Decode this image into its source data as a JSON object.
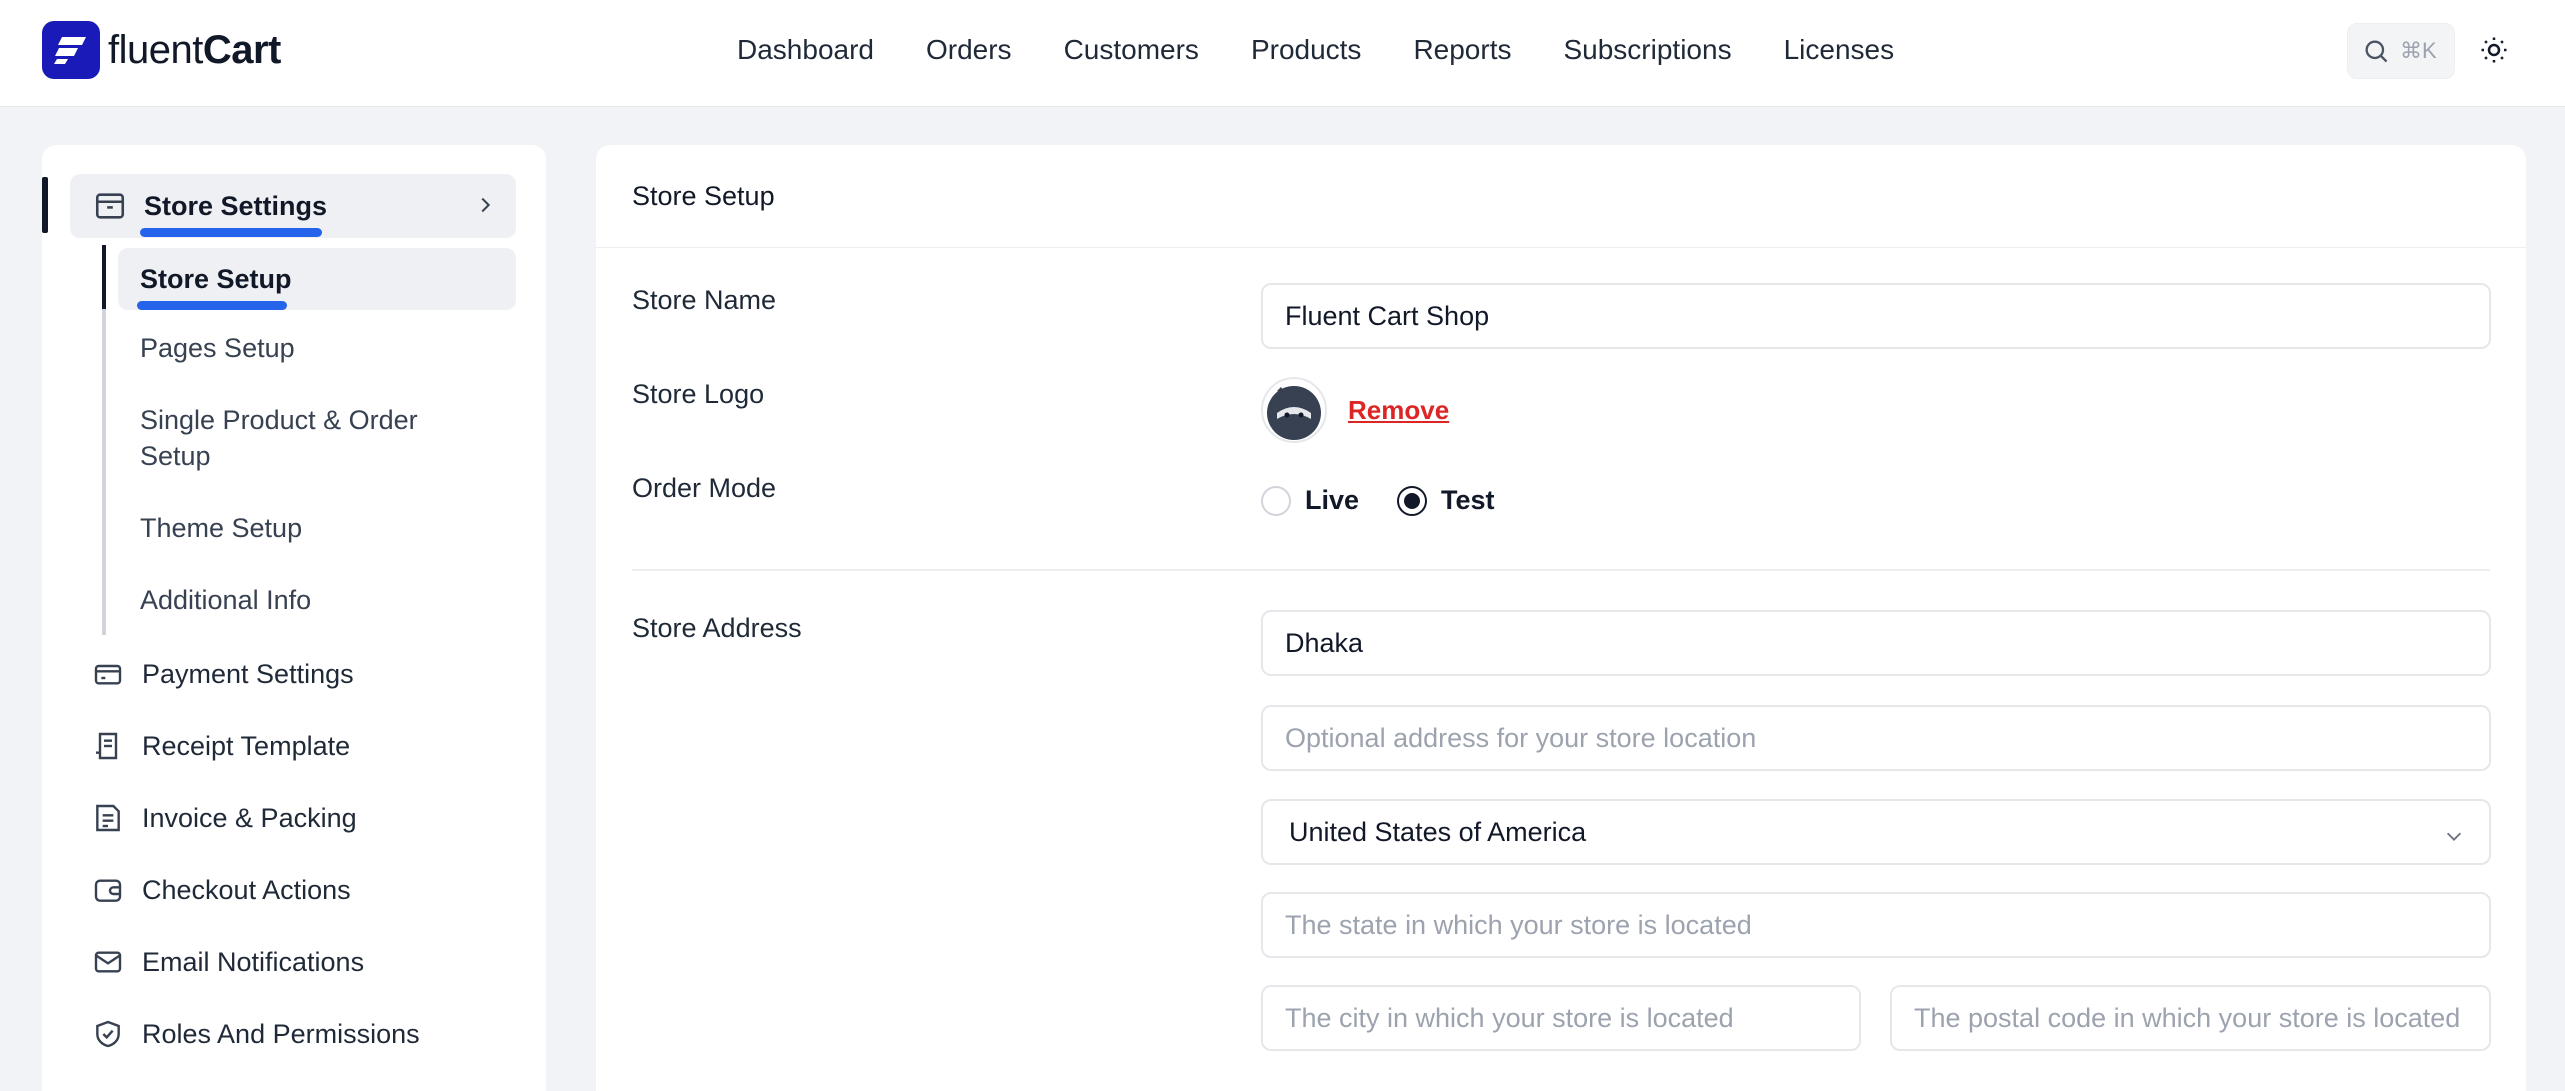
{
  "app": {
    "brand_prefix": "fluent",
    "brand_suffix": "Cart",
    "accent": "#1a1ab8",
    "highlight": "#2563eb"
  },
  "nav": {
    "items": [
      "Dashboard",
      "Orders",
      "Customers",
      "Products",
      "Reports",
      "Subscriptions",
      "Licenses"
    ],
    "search_shortcut": "⌘K"
  },
  "sidebar": {
    "group": {
      "label": "Store Settings",
      "icon": "archive-box-icon"
    },
    "sub_items": [
      "Store Setup",
      "Pages Setup",
      "Single Product & Order Setup",
      "Theme Setup",
      "Additional Info"
    ],
    "items": [
      {
        "label": "Payment Settings",
        "icon": "credit-card-icon"
      },
      {
        "label": "Receipt Template",
        "icon": "receipt-icon"
      },
      {
        "label": "Invoice & Packing",
        "icon": "invoice-icon"
      },
      {
        "label": "Checkout Actions",
        "icon": "wallet-icon"
      },
      {
        "label": "Email Notifications",
        "icon": "envelope-icon"
      },
      {
        "label": "Roles And Permissions",
        "icon": "shield-check-icon"
      }
    ]
  },
  "panel": {
    "title": "Store Setup",
    "store_name": {
      "label": "Store Name",
      "value": "Fluent Cart Shop"
    },
    "store_logo": {
      "label": "Store Logo",
      "remove_label": "Remove"
    },
    "order_mode": {
      "label": "Order Mode",
      "options": [
        "Live",
        "Test"
      ],
      "selected": "Test"
    },
    "store_address": {
      "label": "Store Address",
      "address_line_1": "Dhaka",
      "address_line_2_placeholder": "Optional address for your store location",
      "country": "United States of America",
      "state_placeholder": "The state in which your store is located",
      "city_placeholder": "The city in which your store is located",
      "postal_placeholder": "The postal code in which your store is located"
    }
  }
}
